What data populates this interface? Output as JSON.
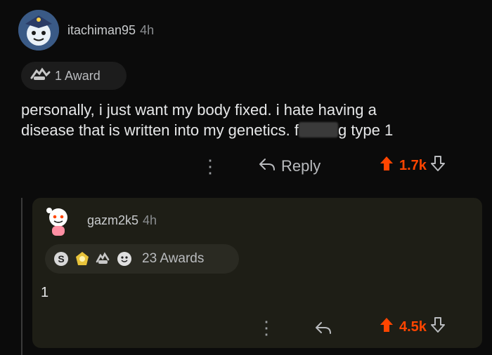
{
  "colors": {
    "upvote": "#ff4500",
    "background": "#0b0b0b",
    "card": "#1e1e16"
  },
  "comment": {
    "username": "itachiman95",
    "age": "4h",
    "award_label": "1 Award",
    "text_line1": "personally, i just want my body fixed. i hate having a",
    "text_line2_start": "disease that is written into my genetics. f",
    "text_line2_end": "g type 1",
    "reply_label": "Reply",
    "score": "1.7k",
    "icons": [
      "avatar-icon",
      "award-icon",
      "more-icon",
      "reply-icon",
      "upvote-icon",
      "downvote-icon"
    ]
  },
  "reply": {
    "username": "gazm2k5",
    "age": "4h",
    "awards_label": "23 Awards",
    "text": "1",
    "score": "4.5k",
    "icons": [
      "snoo-avatar-icon",
      "silver-award-icon",
      "gold-award-icon",
      "hands-award-icon",
      "wholesome-award-icon",
      "more-icon",
      "reply-icon",
      "upvote-icon",
      "downvote-icon"
    ]
  }
}
